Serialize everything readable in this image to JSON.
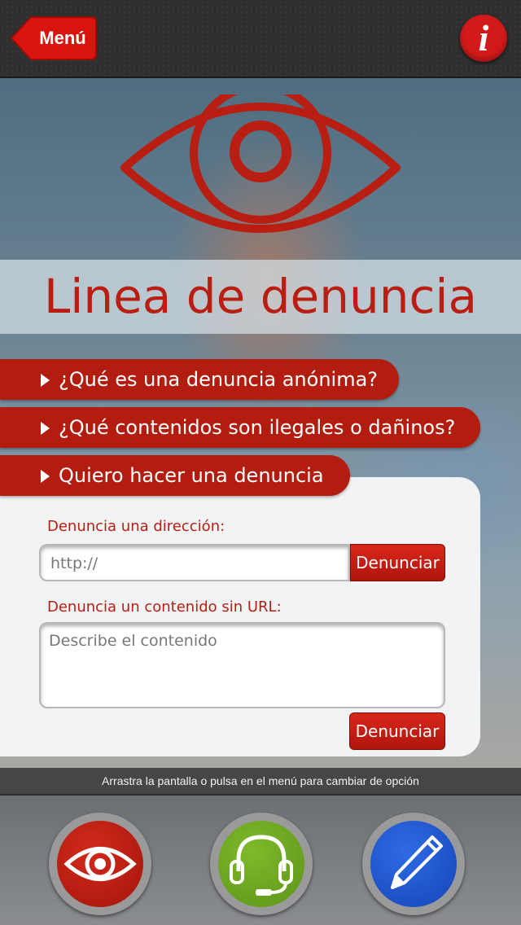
{
  "topbar": {
    "menu_label": "Menú",
    "info_label": "i"
  },
  "page": {
    "title": "Linea de denuncia"
  },
  "accordion": [
    {
      "label": "¿Qué es una denuncia anónima?"
    },
    {
      "label": "¿Qué contenidos son ilegales o dañinos?"
    },
    {
      "label": "Quiero hacer una denuncia"
    }
  ],
  "form": {
    "url_label": "Denuncia una dirección:",
    "url_placeholder": "http://",
    "url_submit": "Denunciar",
    "content_label": "Denuncia un contenido sin URL:",
    "content_placeholder": "Describe el contenido",
    "content_submit": "Denunciar"
  },
  "hint": "Arrastra la pantalla o pulsa en el menú  para cambiar de opción",
  "bottom_nav": [
    {
      "icon": "eye-icon",
      "color": "#b31d0f"
    },
    {
      "icon": "headset-icon",
      "color": "#6aa121"
    },
    {
      "icon": "pencil-icon",
      "color": "#1a57d4"
    }
  ],
  "colors": {
    "accent_red": "#b31d0f",
    "title_red": "#b81f12",
    "topbar": "#2f2f2f"
  }
}
